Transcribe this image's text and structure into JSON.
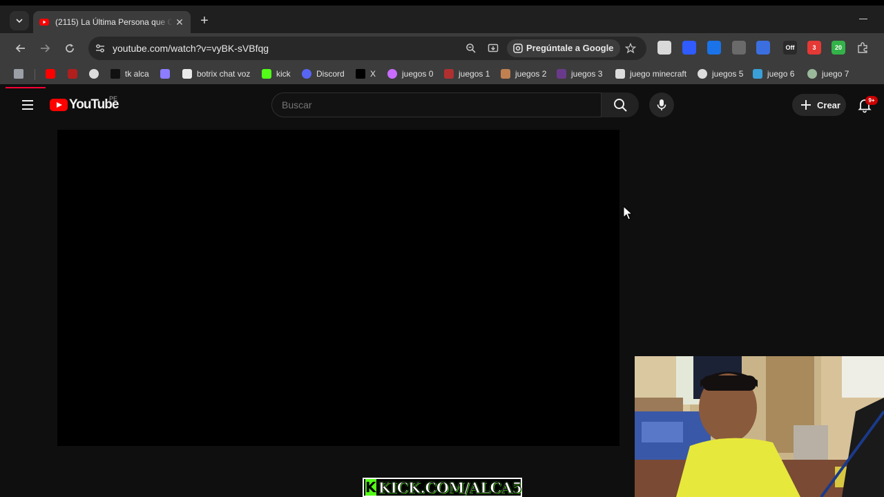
{
  "browser": {
    "tab": {
      "title": "(2115) La Última Persona que C",
      "favicon": "youtube-icon",
      "close_glyph": "✕"
    },
    "new_tab_glyph": "+",
    "url": "youtube.com/watch?v=vyBK-sVBfqg",
    "ask_google_label": "Pregúntale a Google",
    "extensions": [
      {
        "name": "screen-ext-icon",
        "badge": ""
      },
      {
        "name": "firefox-ext-icon",
        "badge": ""
      },
      {
        "name": "shazam-ext-icon",
        "badge": ""
      },
      {
        "name": "glasses-ext-icon",
        "badge": ""
      },
      {
        "name": "translate-ext-icon",
        "badge": ""
      },
      {
        "name": "off-ext-icon",
        "badge": "Off"
      },
      {
        "name": "red-ext-icon",
        "badge": "3"
      },
      {
        "name": "green-ext-icon",
        "badge": "20"
      },
      {
        "name": "puzzle-ext-icon",
        "badge": ""
      }
    ],
    "bookmarks": [
      {
        "label": "",
        "icon": "apps-grid-icon"
      },
      {
        "label": "",
        "icon": "youtube-icon"
      },
      {
        "label": "",
        "icon": "red-logo-icon"
      },
      {
        "label": "",
        "icon": "speedometer-icon"
      },
      {
        "label": "tk alca",
        "icon": "tiktok-icon"
      },
      {
        "label": "",
        "icon": "swirl-icon"
      },
      {
        "label": "botrix chat voz",
        "icon": "diamond-icon"
      },
      {
        "label": "kick",
        "icon": "kick-icon"
      },
      {
        "label": "Discord",
        "icon": "discord-icon"
      },
      {
        "label": "X",
        "icon": "x-icon"
      },
      {
        "label": "juegos 0",
        "icon": "gradient-orb-icon"
      },
      {
        "label": "juegos 1",
        "icon": "joystick-icon"
      },
      {
        "label": "juegos 2",
        "icon": "face-icon"
      },
      {
        "label": "juegos 3",
        "icon": "game-art-icon"
      },
      {
        "label": "juego minecraft",
        "icon": "k-icon"
      },
      {
        "label": "juegos 5",
        "icon": "globe-icon"
      },
      {
        "label": "juego 6",
        "icon": "colorful-icon"
      },
      {
        "label": "juego 7",
        "icon": "badge-icon"
      }
    ]
  },
  "youtube": {
    "logo_text": "YouTube",
    "country_code": "PE",
    "search_placeholder": "Buscar",
    "create_label": "Crear",
    "notification_count": "9+"
  },
  "overlay": {
    "kick_logo": "K",
    "kick_text": "KICK.COM/ALCA5"
  },
  "colors": {
    "youtube_red": "#ff0000",
    "kick_green": "#53fc18",
    "page_bg": "#0f0f0f",
    "player_bg": "#000000"
  }
}
